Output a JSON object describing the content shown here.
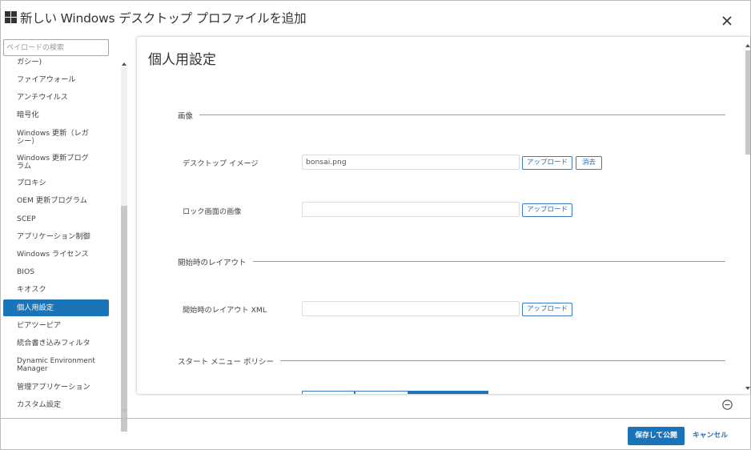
{
  "header": {
    "title": "新しい Windows デスクトップ プロファイルを追加",
    "logo_icon": "windows-logo-icon",
    "close_icon": "close-icon"
  },
  "sidebar": {
    "search_placeholder": "ペイロードの検索",
    "items": [
      {
        "label": "ガシー)"
      },
      {
        "label": "ファイアウォール"
      },
      {
        "label": "アンチウイルス"
      },
      {
        "label": "暗号化"
      },
      {
        "label": "Windows 更新（レガシー）"
      },
      {
        "label": "Windows 更新プログラム"
      },
      {
        "label": "プロキシ"
      },
      {
        "label": "OEM 更新プログラム"
      },
      {
        "label": "SCEP"
      },
      {
        "label": "アプリケーション制御"
      },
      {
        "label": "Windows ライセンス"
      },
      {
        "label": "BIOS"
      },
      {
        "label": "キオスク"
      },
      {
        "label": "個人用設定",
        "active": true
      },
      {
        "label": "ピアツーピア"
      },
      {
        "label": "統合書き込みフィルタ"
      },
      {
        "label": "Dynamic Environment Manager"
      },
      {
        "label": "管理アプリケーション"
      },
      {
        "label": "カスタム設定"
      }
    ]
  },
  "content": {
    "title": "個人用設定",
    "sections": [
      {
        "label": "画像"
      },
      {
        "label": "開始時のレイアウト"
      },
      {
        "label": "スタート メニュー ポリシー"
      }
    ],
    "fields": {
      "desktop_image": {
        "label": "デスクトップ イメージ",
        "value": "bonsai.png",
        "upload": "アップロード",
        "clear": "消去"
      },
      "lock_image": {
        "label": "ロック画面の画像",
        "value": "",
        "upload": "アップロード"
      },
      "start_layout": {
        "label": "開始時のレイアウト XML",
        "value": "",
        "upload": "アップロード"
      }
    }
  },
  "footer": {
    "save_label": "保存して公開",
    "cancel_label": "キャンセル"
  },
  "colors": {
    "accent": "#1b73b8",
    "link": "#2d6db3"
  }
}
